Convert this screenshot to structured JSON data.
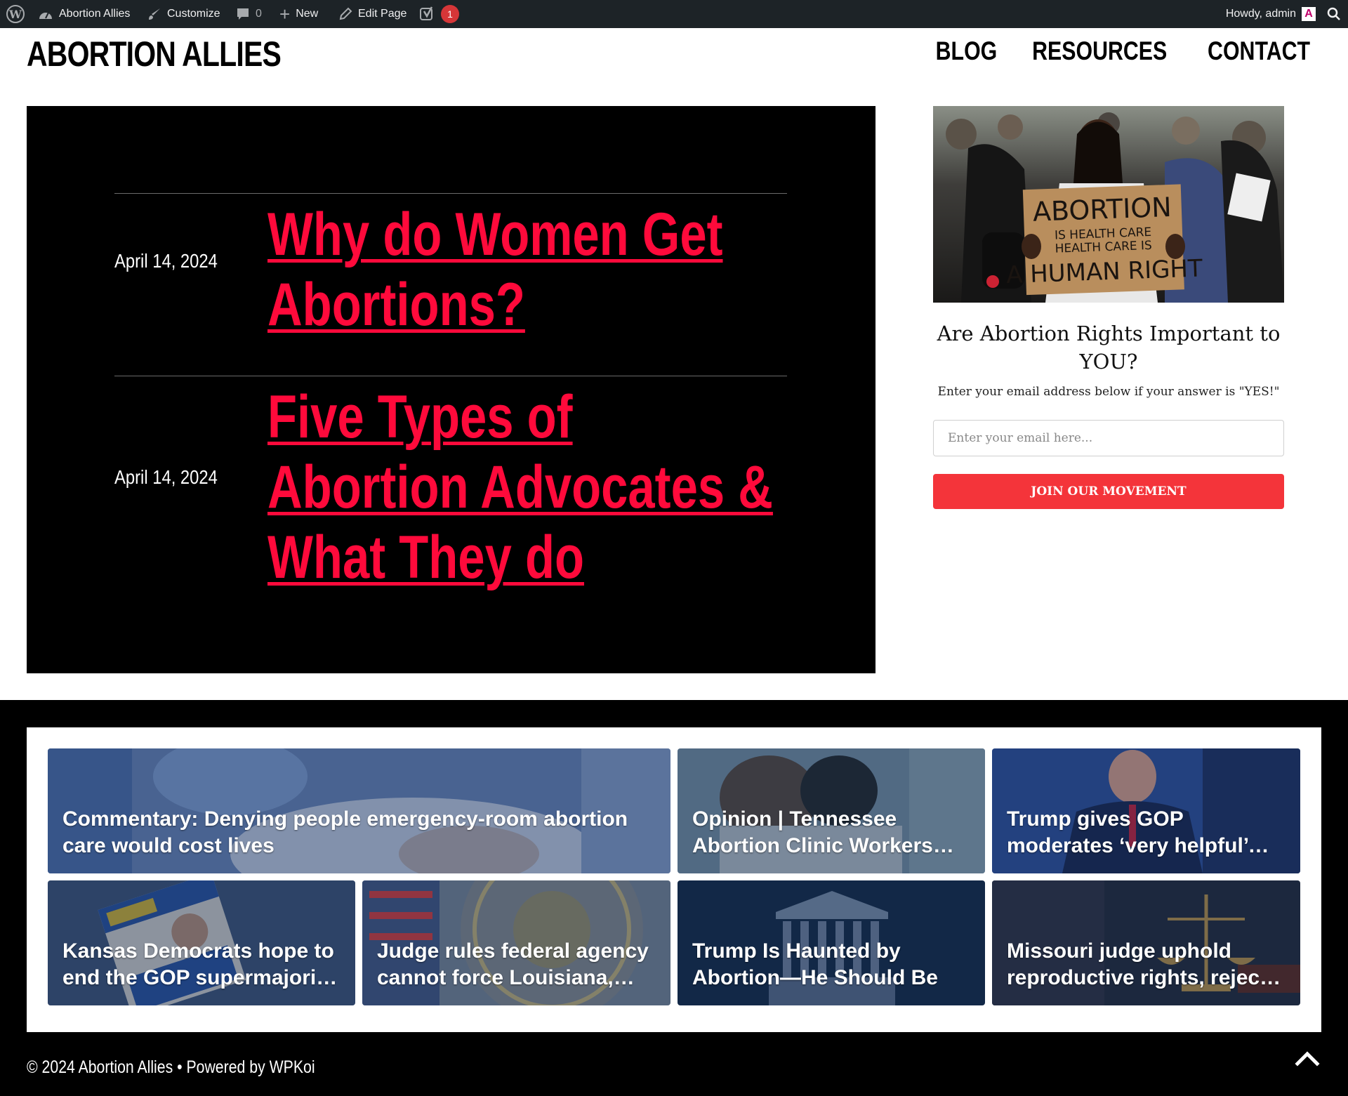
{
  "admin_bar": {
    "wp_logo_icon": "wordpress-icon",
    "site_name": "Abortion Allies",
    "customize": "Customize",
    "comments_count": "0",
    "new_label": "New",
    "edit_page": "Edit Page",
    "notifications_count": "1",
    "howdy": "Howdy, admin",
    "avatar_letter": "A"
  },
  "header": {
    "site_title": "ABORTION ALLIES",
    "nav": [
      "BLOG",
      "RESOURCES",
      "CONTACT"
    ]
  },
  "posts": [
    {
      "date": "April 14, 2024",
      "title": "Why do Women Get Abortions?"
    },
    {
      "date": "April 14, 2024",
      "title": "Five Types of Abortion Advocates & What They do"
    }
  ],
  "sidebar": {
    "image_sign_lines": [
      "ABORTION",
      "IS HEALTH CARE",
      "HEALTH CARE IS",
      "A HUMAN RIGHT"
    ],
    "heading": "Are Abortion Rights Important to YOU?",
    "text": "Enter your email address below if your answer is \"YES!\"",
    "email_placeholder": "Enter your email here...",
    "button_label": "JOIN OUR MOVEMENT"
  },
  "news": [
    {
      "title": "Commentary: Denying people emergency-room abortion care would cost lives"
    },
    {
      "title": "Opinion | Tennessee Abortion Clinic Workers Are Bracing for What's Next"
    },
    {
      "title": "Trump gives GOP moderates ‘very helpful’ cover on abortion"
    },
    {
      "title": "Kansas Democrats hope to end the GOP supermajority in the legislature"
    },
    {
      "title": "Judge rules federal agency cannot force Louisiana, Mississippi employers"
    },
    {
      "title": "Trump Is Haunted by Abortion—He Should Be"
    },
    {
      "title": "Missouri judge uphold reproductive rights, rejects challenge"
    }
  ],
  "footer": {
    "copyright": "© 2024 Abortion Allies • Powered by ",
    "powered_link": "WPKoi",
    "scroll_top_icon": "chevron-up-icon"
  },
  "colors": {
    "accent_red": "#ff0a3b",
    "button_red": "#f4343a",
    "admin_bar": "#1d2327"
  }
}
